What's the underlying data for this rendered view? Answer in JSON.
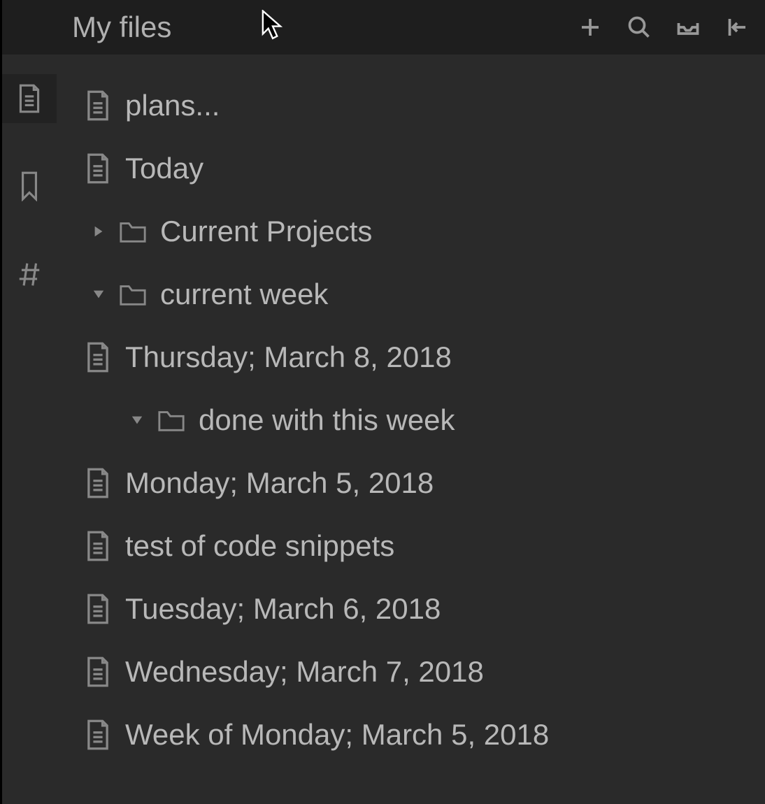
{
  "header": {
    "title": "My files"
  },
  "sidebar": {
    "items": [
      {
        "name": "files",
        "active": true
      },
      {
        "name": "bookmarks",
        "active": false
      },
      {
        "name": "tags",
        "active": false
      }
    ]
  },
  "tree": {
    "items": [
      {
        "type": "file",
        "label": "plans...",
        "indent": 0,
        "disclosure": null
      },
      {
        "type": "file",
        "label": "Today",
        "indent": 0,
        "disclosure": null
      },
      {
        "type": "folder",
        "label": "Current Projects",
        "indent": 1,
        "disclosure": "closed"
      },
      {
        "type": "folder",
        "label": "current week",
        "indent": 1,
        "disclosure": "open"
      },
      {
        "type": "file",
        "label": "Thursday; March 8, 2018",
        "indent": 2,
        "disclosure": null
      },
      {
        "type": "folder",
        "label": "done with this week",
        "indent": 3,
        "disclosure": "open"
      },
      {
        "type": "file",
        "label": "Monday; March 5, 2018",
        "indent": 4,
        "disclosure": null
      },
      {
        "type": "file",
        "label": "test of code snippets",
        "indent": 4,
        "disclosure": null
      },
      {
        "type": "file",
        "label": "Tuesday; March 6, 2018",
        "indent": 4,
        "disclosure": null
      },
      {
        "type": "file",
        "label": "Wednesday; March 7, 2018",
        "indent": 2,
        "disclosure": null
      },
      {
        "type": "file",
        "label": "Week of Monday; March 5, 2018",
        "indent": 2,
        "disclosure": null
      }
    ]
  }
}
